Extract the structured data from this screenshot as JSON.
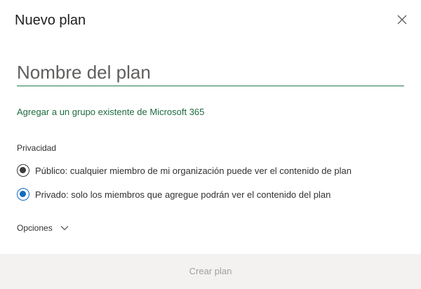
{
  "dialog": {
    "title": "Nuevo plan",
    "close_icon": "close-icon"
  },
  "form": {
    "plan_name_placeholder": "Nombre del plan",
    "plan_name_value": "",
    "group_link": "Agregar a un grupo existente de Microsoft 365",
    "privacy_label": "Privacidad",
    "privacy_options": [
      {
        "label": "Público: cualquier miembro de mi organización puede ver el contenido de plan",
        "style": "dark"
      },
      {
        "label": "Privado: solo los miembros que agregue podrán ver el contenido del plan",
        "style": "selected"
      }
    ],
    "options_label": "Opciones",
    "options_icon": "chevron-down-icon"
  },
  "footer": {
    "create_label": "Crear plan",
    "create_enabled": false
  },
  "colors": {
    "accent_green": "#1e6b3f",
    "input_underline": "#237b4b",
    "radio_selected": "#0f6cbd",
    "footer_bg": "#f3f2f1",
    "disabled_text": "#a19f9d"
  }
}
